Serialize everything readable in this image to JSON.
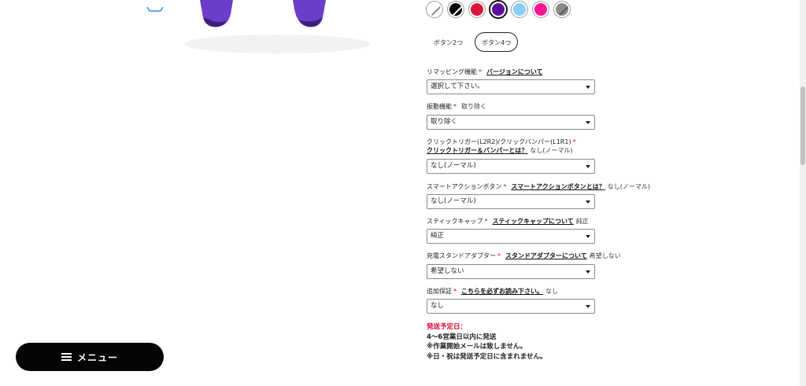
{
  "colors": {
    "accent_red": "#e4002b",
    "swatches": [
      "#ffffff",
      "#000000",
      "#dc143c",
      "#5b0fa0",
      "#87cefa",
      "#ff1493",
      "#8a8a8a"
    ]
  },
  "button_options": [
    {
      "label": "ボタン2つ",
      "selected": false
    },
    {
      "label": "ボタン4つ",
      "selected": true
    }
  ],
  "fields": [
    {
      "label": "リマッピング機能",
      "link": "バージョンについて",
      "note": "",
      "value": "選択して下さい。"
    },
    {
      "label": "振動機能",
      "link": "",
      "note": "取り除く",
      "value": "取り除く"
    },
    {
      "label": "クリックトリガー(L2R2)/クリックバンパー(L1R1)",
      "link": "クリックトリガー＆バンパーとは？",
      "note": "なし(ノーマル)",
      "value": "なし(ノーマル)"
    },
    {
      "label": "スマートアクションボタン",
      "link": "スマートアクションボタンとは？",
      "note": "なし(ノーマル)",
      "value": "なし(ノーマル)"
    },
    {
      "label": "スティックキャップ",
      "link": "スティックキャップについて",
      "note": "純正",
      "value": "純正"
    },
    {
      "label": "充電スタンドアダプター",
      "link": "スタンドアダプターについて",
      "note": "希望しない",
      "value": "希望しない"
    },
    {
      "label": "追加保証",
      "link": "こちらを必ずお読み下さい。",
      "note": "なし",
      "value": "なし"
    }
  ],
  "shipping": {
    "title": "発送予定日：",
    "lines": [
      "4〜6営業日以内に発送",
      "※作業開始メールは致しません。",
      "※日・祝は発送予定日に含まれません。"
    ]
  },
  "menu": {
    "label": "メニュー",
    "icon": "hamburger-icon"
  }
}
